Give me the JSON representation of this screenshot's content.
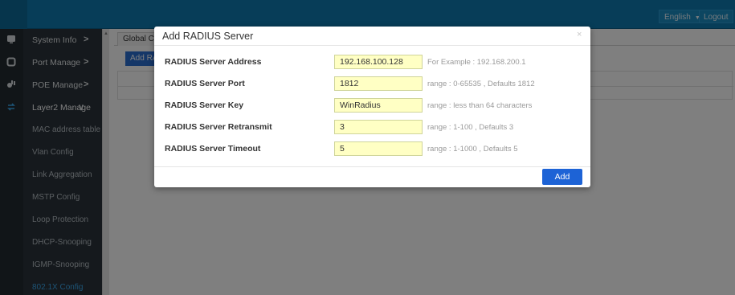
{
  "topbar": {
    "language": "English",
    "language_caret": "▼",
    "logout": "Logout"
  },
  "sidebar": {
    "items": [
      {
        "label": "System Info",
        "icon": "monitor-icon",
        "chevron": ">"
      },
      {
        "label": "Port Manage",
        "icon": "square-icon",
        "chevron": ">"
      },
      {
        "label": "POE Manage",
        "icon": "poe-icon",
        "chevron": ">"
      },
      {
        "label": "Layer2 Manage",
        "icon": "switch-icon",
        "chevron": "∨"
      }
    ],
    "sub_items": [
      "MAC address table",
      "Vlan Config",
      "Link Aggregation",
      "MSTP Config",
      "Loop Protection",
      "DHCP-Snooping",
      "IGMP-Snooping",
      "802.1X Config"
    ]
  },
  "content": {
    "tab_label": "Global Cor",
    "add_button_label": "Add RA"
  },
  "modal": {
    "title": "Add RADIUS Server",
    "close": "×",
    "fields": [
      {
        "label": "RADIUS Server Address",
        "value": "192.168.100.128",
        "hint": "For Example : 192.168.200.1"
      },
      {
        "label": "RADIUS Server Port",
        "value": "1812",
        "hint": "range : 0-65535 , Defaults 1812"
      },
      {
        "label": "RADIUS Server Key",
        "value": "WinRadius",
        "hint": "range : less than 64 characters"
      },
      {
        "label": "RADIUS Server Retransmit",
        "value": "3",
        "hint": "range : 1-100 , Defaults 3"
      },
      {
        "label": "RADIUS Server Timeout",
        "value": "5",
        "hint": "range : 1-1000 , Defaults 5"
      }
    ],
    "add_button": "Add"
  },
  "colors": {
    "topbar": "#0f7bb1",
    "sidebar": "#2a333a",
    "active_link": "#3aa6ea",
    "input_bg": "#ffffc4",
    "primary_button": "#1d63d6"
  }
}
